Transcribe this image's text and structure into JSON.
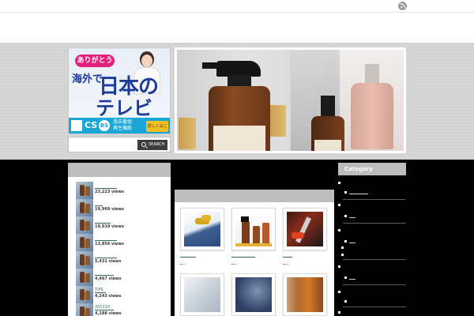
{
  "colors": {
    "accent_link": "#2f6d63",
    "category_head_bg": "#bdbdbd",
    "ad_pink": "#e4207d",
    "ad_blue": "#1aa7d8"
  },
  "header": {
    "rss_icon": "rss-icon"
  },
  "ad": {
    "pill": "ありがとう",
    "line1": "海外で",
    "line2": "日本の",
    "line3": "テレビ",
    "cs": "CS",
    "bs": "BS",
    "sub": "過去番組 再生機能",
    "button": "詳しくはこちら"
  },
  "search": {
    "placeholder": "",
    "button_label": "SEARCH"
  },
  "ranking": [
    {
      "views": "23,223 views"
    },
    {
      "views": "19,969 views"
    },
    {
      "views": "19,619 views"
    },
    {
      "views": "13,856 views"
    },
    {
      "views": "5,431 views"
    },
    {
      "views": "4,667 views"
    },
    {
      "title": "TIPS",
      "views": "4,243 views"
    },
    {
      "title": "201310",
      "views": "4,188 views"
    }
  ],
  "sidebar": {
    "category_title": "Category"
  }
}
